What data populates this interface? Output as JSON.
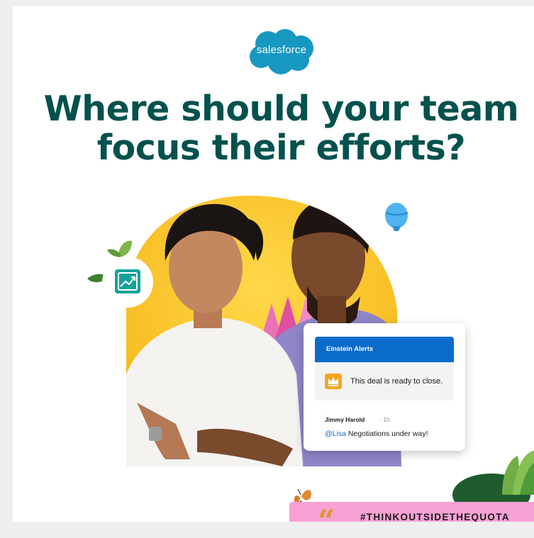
{
  "logo": {
    "text": "salesforce",
    "brand_color": "#1798c1"
  },
  "headline": {
    "line1": "Where should your team",
    "line2": "focus their efforts?",
    "color": "#03514d"
  },
  "alert_card": {
    "header_title": "Einstein Alerts",
    "header_color": "#0b6bcb",
    "message": "This deal is ready to close.",
    "author": "Jimmy Harold",
    "time": "· 1h",
    "mention": "@Lisa",
    "comment": " Negotiations under way!"
  },
  "footer": {
    "hashtag": "#THINKOUTSIDETHEQUOTA",
    "quote_glyph": "“",
    "bar_color": "#f7a1d4"
  },
  "icons": [
    "chart-growth-icon",
    "balloon-icon",
    "crown-icon",
    "butterfly-icon",
    "leaf-icon",
    "bush-icon"
  ]
}
